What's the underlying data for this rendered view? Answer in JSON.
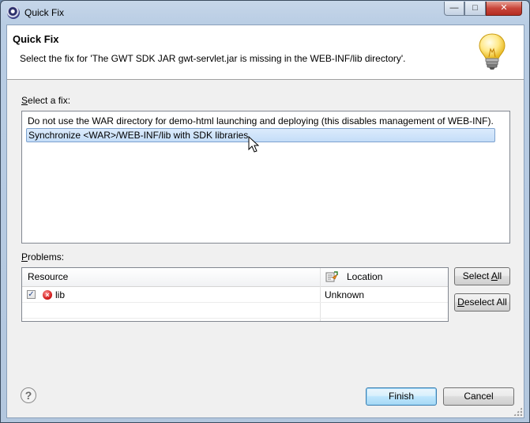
{
  "window": {
    "title": "Quick Fix",
    "controls": {
      "minimize": "—",
      "maximize": "□",
      "close": "✕"
    }
  },
  "header": {
    "title": "Quick Fix",
    "description": "Select the fix for 'The GWT SDK JAR gwt-servlet.jar is missing in the WEB-INF/lib directory'.",
    "icon": "lightbulb-icon"
  },
  "fixes": {
    "label_prefix": "S",
    "label_rest": "elect a fix:",
    "items": [
      {
        "text": "Do not use the WAR directory for demo-html launching and deploying (this disables management of WEB-INF).",
        "selected": false
      },
      {
        "text": "Synchronize <WAR>/WEB-INF/lib with SDK libraries",
        "selected": true
      }
    ]
  },
  "problems": {
    "label_prefix": "P",
    "label_rest": "roblems:",
    "columns": {
      "resource": "Resource",
      "location": "Location"
    },
    "rows": [
      {
        "checked": true,
        "resource": "lib",
        "location": "Unknown",
        "icon": "error-icon"
      }
    ]
  },
  "buttons": {
    "select_all_prefix": "Select ",
    "select_all_mnemonic": "A",
    "select_all_rest": "ll",
    "deselect_all_prefix": "",
    "deselect_all_mnemonic": "D",
    "deselect_all_rest": "eselect All",
    "finish": "Finish",
    "cancel": "Cancel",
    "help": "?"
  },
  "colors": {
    "selection_bg": "#c4ddf8",
    "selection_border": "#7da2ce",
    "title_bar": "#b9cde4",
    "close_button": "#c8453a"
  }
}
